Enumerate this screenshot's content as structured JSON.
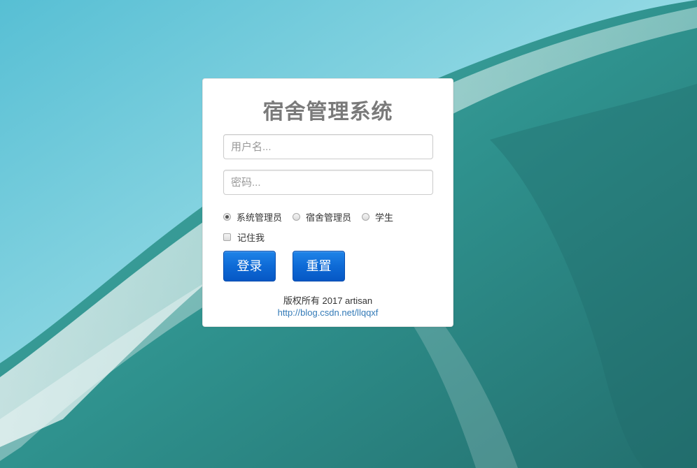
{
  "login": {
    "title": "宿舍管理系统",
    "username_placeholder": "用户名...",
    "password_placeholder": "密码...",
    "roles": [
      {
        "label": "系统管理员",
        "selected": true
      },
      {
        "label": "宿舍管理员",
        "selected": false
      },
      {
        "label": "学生",
        "selected": false
      }
    ],
    "remember_label": "记住我",
    "remember_checked": false,
    "login_button": "登录",
    "reset_button": "重置",
    "copyright": "版权所有 2017 artisan",
    "link": "http://blog.csdn.net/llqqxf"
  },
  "colors": {
    "title": "#7a7a7a",
    "button": "#0e6ad6",
    "link": "#337ab7"
  }
}
